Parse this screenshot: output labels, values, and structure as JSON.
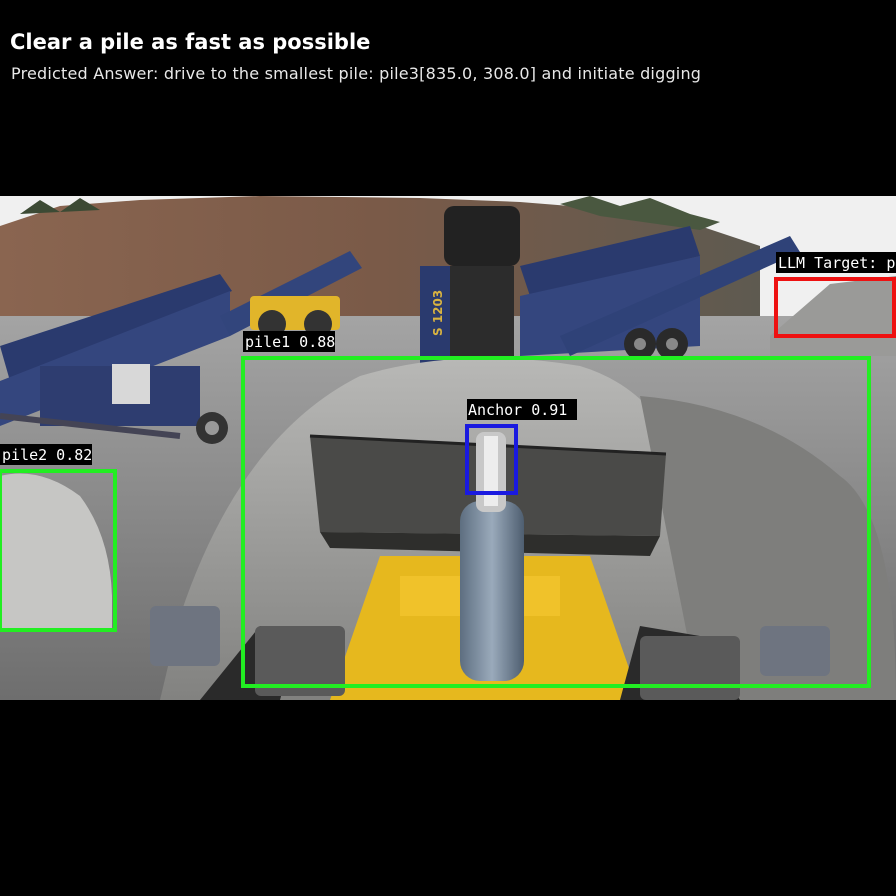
{
  "task": {
    "title": "Clear a pile as fast as possible",
    "predicted_answer": "Predicted Answer: drive to the smallest pile: pile3[835.0, 308.0] and initiate digging"
  },
  "detections": [
    {
      "label": "pile1 0.88",
      "color": "#22ee22"
    },
    {
      "label": "pile2 0.82",
      "color": "#22ee22"
    },
    {
      "label": "Anchor 0.91",
      "color": "#1a1ae0"
    },
    {
      "label": "LLM Target: p",
      "color": "#ee1111"
    }
  ],
  "scene": {
    "machine_marking": "S 1203",
    "colors": {
      "sky": "#f2f2f2",
      "cliff": "#7a5a48",
      "gravel": "#8d8d8d",
      "machine_blue": "#2a3a6e",
      "loader_yellow": "#e8b820"
    }
  }
}
